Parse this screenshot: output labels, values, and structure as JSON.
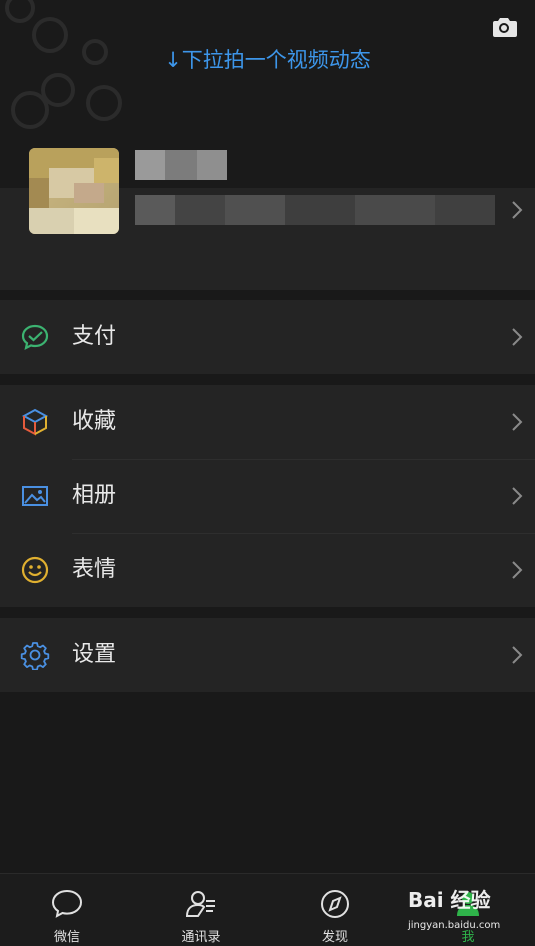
{
  "header": {
    "pull_hint": "↓下拉拍一个视频动态"
  },
  "menu": {
    "pay_label": "支付",
    "favorites_label": "收藏",
    "album_label": "相册",
    "stickers_label": "表情",
    "settings_label": "设置"
  },
  "tabs": [
    {
      "label": "微信"
    },
    {
      "label": "通讯录"
    },
    {
      "label": "发现"
    },
    {
      "label": "我"
    }
  ],
  "watermark": {
    "text": "Bai 经验",
    "sub": "jingyan.baidu.com"
  },
  "colors": {
    "accent_blue": "#3d96ea",
    "pay_green": "#3cb371",
    "stickers_yellow": "#e0b030",
    "active_tab": "#2fb34a"
  }
}
